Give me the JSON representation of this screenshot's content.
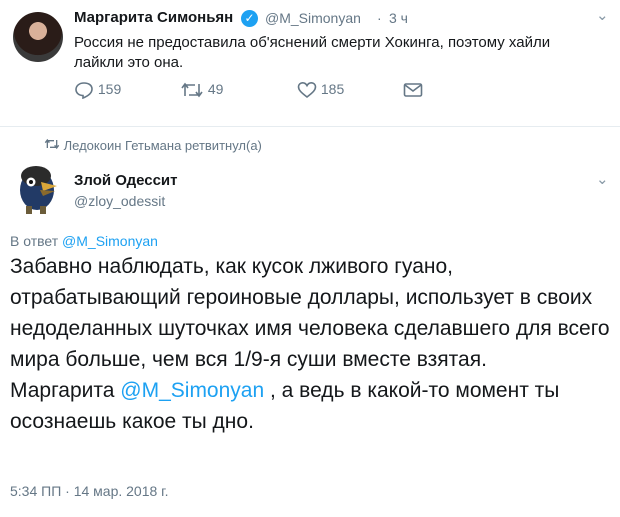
{
  "tweet1": {
    "author_name": "Маргарита Симоньян",
    "verified_icon": "verified-badge-icon",
    "handle": "@M_Simonyan",
    "separator": "·",
    "time": "3 ч",
    "text": "Россия не предоставила об'яснений смерти Хокинга, поэтому хайли лайкли это она.",
    "reply_count": "159",
    "retweet_count": "49",
    "like_count": "185"
  },
  "retweet_notice": "Ледокоин Гетьмана ретвитнул(а)",
  "tweet2": {
    "author_name": "Злой Одессит",
    "handle": "@zloy_odessit",
    "reply_to_prefix": "В ответ",
    "reply_to_handle": "@M_Simonyan",
    "text_part1": "Забавно наблюдать, как кусок лживого гуано, отрабатывающий героиновые доллары, использует в своих недоделанных шуточках имя человека сделавшего для всего мира больше, чем вся 1/9-я суши вместе взятая.",
    "text_part2_prefix": "Маргарита ",
    "text_part2_mention": "@M_Simonyan",
    "text_part2_suffix": " , а ведь в какой-то момент ты осознаешь какое ты дно.",
    "timestamp": "5:34 ПП · 14 мар. 2018 г."
  },
  "colors": {
    "link": "#1da1f2",
    "muted": "#657786",
    "text": "#14171a"
  }
}
